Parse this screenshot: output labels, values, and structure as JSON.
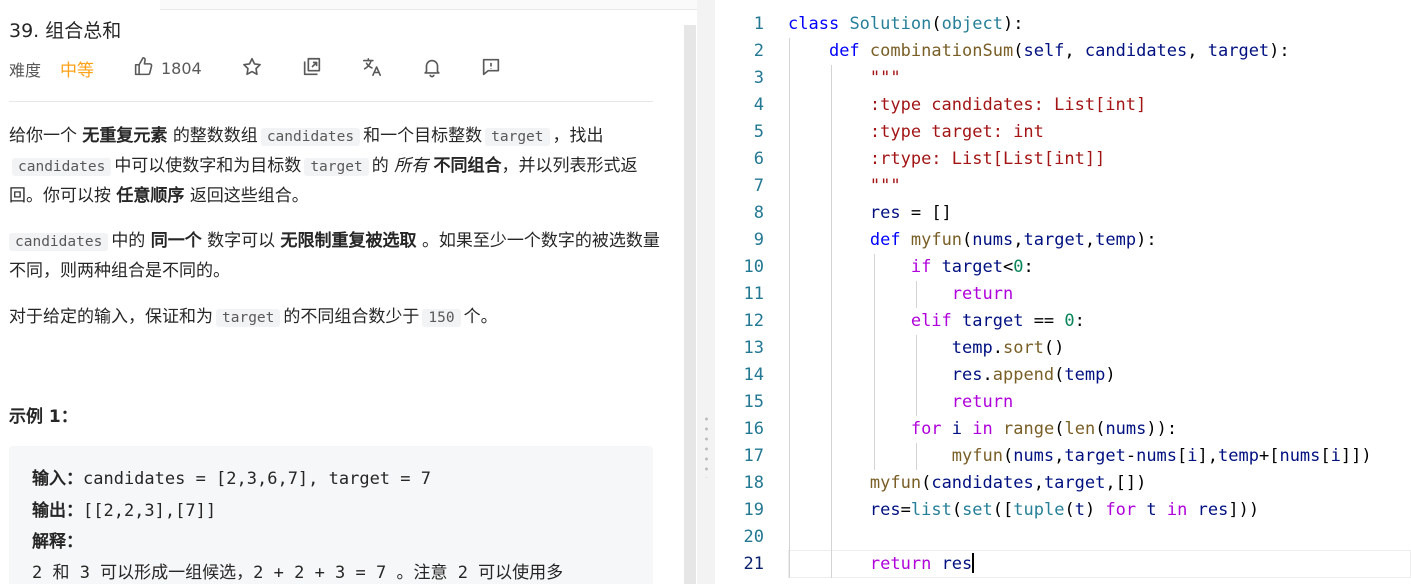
{
  "problem": {
    "title": "39. 组合总和",
    "difficulty_label": "难度",
    "difficulty_value": "中等",
    "like_count": "1804",
    "accent_color": "#ffa116",
    "icons": [
      "like-icon",
      "star-icon",
      "share-icon",
      "translate-icon",
      "bell-icon",
      "feedback-icon"
    ]
  },
  "description": {
    "p1": {
      "t1": "给你一个",
      "b1": "无重复元素",
      "t2": "的整数数组",
      "c1": "candidates",
      "t3": "和一个目标整数",
      "c2": "target",
      "t4": "，找出",
      "c3": "candidates",
      "t5": "中可以使数字和为目标数",
      "c4": "target",
      "t6": "的",
      "i1": "所有",
      "b2": "不同组合",
      "t7": "，并以列表形式返回。你可以按",
      "b3": "任意顺序",
      "t8": "返回这些组合。"
    },
    "p2": {
      "c1": "candidates",
      "t1": "中的",
      "b1": "同一个",
      "t2": "数字可以",
      "b2": "无限制重复被选取",
      "t3": "。如果至少一个数字的被选数量不同，则两种组合是不同的。"
    },
    "p3": {
      "t1": "对于给定的输入，保证和为",
      "c1": "target",
      "t2": "的不同组合数少于",
      "c2": "150",
      "t3": "个。"
    }
  },
  "example": {
    "heading": "示例 1：",
    "input_label": "输入：",
    "input_value": "candidates = [2,3,6,7], target = 7",
    "output_label": "输出：",
    "output_value": "[[2,2,3],[7]]",
    "explain_label": "解释：",
    "explain_text": "2 和 3 可以形成一组候选，2 + 2 + 3 = 7 。注意 2 可以使用多"
  },
  "editor": {
    "line_numbers": [
      "1",
      "2",
      "3",
      "4",
      "5",
      "6",
      "7",
      "8",
      "9",
      "10",
      "11",
      "12",
      "13",
      "14",
      "15",
      "16",
      "17",
      "18",
      "19",
      "20",
      "21"
    ],
    "tokens": {
      "l1": [
        "class",
        "Solution",
        "(",
        "object",
        "):"
      ],
      "l2": [
        "def",
        "combinationSum",
        "(",
        "self",
        ", ",
        "candidates",
        ", ",
        "target",
        "):"
      ],
      "l3": [
        "\"\"\""
      ],
      "l4": [
        ":type candidates: List[int]"
      ],
      "l5": [
        ":type target: int"
      ],
      "l6": [
        ":rtype: List[List[int]]"
      ],
      "l7": [
        "\"\"\""
      ],
      "l8": [
        "res",
        " = []"
      ],
      "l9": [
        "def",
        "myfun",
        "(",
        "nums",
        ",",
        "target",
        ",",
        "temp",
        "):"
      ],
      "l10": [
        "if",
        "target",
        "<",
        "0",
        ":"
      ],
      "l11": [
        "return"
      ],
      "l12": [
        "elif",
        "target",
        " == ",
        "0",
        ":"
      ],
      "l13": [
        "temp",
        ".",
        "sort",
        "()"
      ],
      "l14": [
        "res",
        ".",
        "append",
        "(",
        "temp",
        ")"
      ],
      "l15": [
        "return"
      ],
      "l16": [
        "for",
        "i",
        "in",
        "range",
        "(",
        "len",
        "(",
        "nums",
        ")):"
      ],
      "l17": [
        "myfun",
        "(",
        "nums",
        ",",
        "target",
        "-",
        "nums",
        "[",
        "i",
        "],",
        "temp",
        "+[",
        "nums",
        "[",
        "i",
        "]])"
      ],
      "l18": [
        "myfun",
        "(",
        "candidates",
        ",",
        "target",
        ",[])"
      ],
      "l19": [
        "res",
        "=",
        "list",
        "(",
        "set",
        "([",
        "tuple",
        "(",
        "t",
        ") ",
        "for",
        "t",
        "in",
        "res",
        "]))"
      ],
      "l21": [
        "return",
        "res"
      ]
    }
  }
}
